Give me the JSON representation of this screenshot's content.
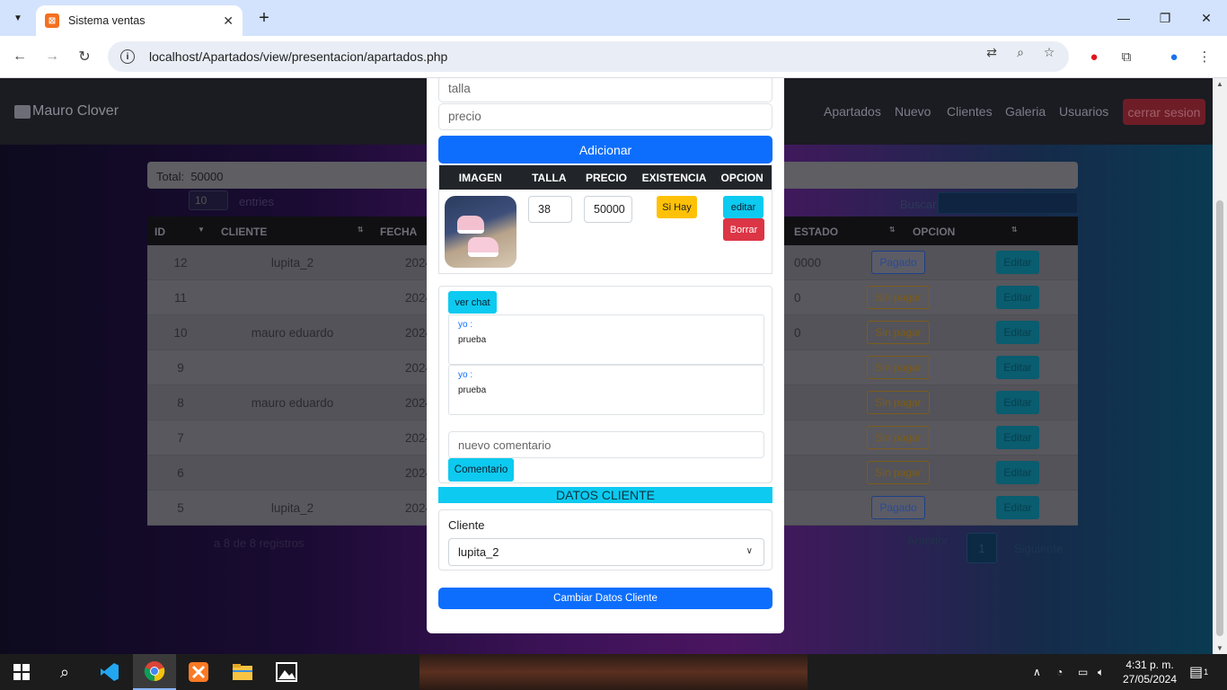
{
  "browser": {
    "tab_title": "Sistema ventas",
    "url": "localhost/Apartados/view/presentacion/apartados.php"
  },
  "navbar": {
    "brand": "Mauro Clover",
    "links": [
      "Apartados",
      "Nuevo",
      "Clientes",
      "Galeria",
      "Usuarios"
    ],
    "logout": "cerrar sesion"
  },
  "list": {
    "total_label": "Total:",
    "total_value": "50000",
    "length_value": "10",
    "length_label": "entries",
    "search_label": "Buscar:",
    "columns": [
      "ID",
      "CLIENTE",
      "FECHA",
      "ESTADO",
      "OPCION"
    ],
    "rows": [
      {
        "id": "12",
        "cliente": "lupita_2",
        "fecha": "2024",
        "total": "0000",
        "estado": "Pagado",
        "opcion": "Editar"
      },
      {
        "id": "11",
        "cliente": "",
        "fecha": "2024",
        "total": "0",
        "estado": "Sin pagar",
        "opcion": "Editar"
      },
      {
        "id": "10",
        "cliente": "mauro eduardo",
        "fecha": "2024",
        "total": "0",
        "estado": "Sin pagar",
        "opcion": "Editar"
      },
      {
        "id": "9",
        "cliente": "",
        "fecha": "2024",
        "total": "",
        "estado": "Sin pagar",
        "opcion": "Editar"
      },
      {
        "id": "8",
        "cliente": "mauro eduardo",
        "fecha": "2024",
        "total": "",
        "estado": "Sin pagar",
        "opcion": "Editar"
      },
      {
        "id": "7",
        "cliente": "",
        "fecha": "2024",
        "total": "",
        "estado": "Sin pagar",
        "opcion": "Editar"
      },
      {
        "id": "6",
        "cliente": "",
        "fecha": "2024",
        "total": "",
        "estado": "Sin pagar",
        "opcion": "Editar"
      },
      {
        "id": "5",
        "cliente": "lupita_2",
        "fecha": "2024",
        "total": "",
        "estado": "Pagado",
        "opcion": "Editar"
      }
    ],
    "info": "a 8 de 8 registros",
    "pager_prev": "Anterior",
    "pager_page": "1",
    "pager_next": "Siguiente"
  },
  "modal": {
    "talla_placeholder": "talla",
    "precio_placeholder": "precio",
    "add_button": "Adicionar",
    "table_headers": [
      "IMAGEN",
      "TALLA",
      "PRECIO",
      "EXISTENCIA",
      "OPCION"
    ],
    "product": {
      "talla": "38",
      "precio": "50000",
      "existencia": "Si Hay",
      "edit": "editar",
      "delete": "Borrar"
    },
    "chat_button": "ver chat",
    "messages": [
      {
        "who": "yo :",
        "text": "prueba"
      },
      {
        "who": "yo :",
        "text": "prueba"
      }
    ],
    "comment_placeholder": "nuevo comentario",
    "comment_button": "Comentario",
    "datos_header": "DATOS CLIENTE",
    "cliente_label": "Cliente",
    "cliente_value": "lupita_2",
    "change_button": "Cambiar Datos Cliente"
  },
  "taskbar": {
    "time": "4:31 p. m.",
    "date": "27/05/2024",
    "notif_count": "1"
  }
}
